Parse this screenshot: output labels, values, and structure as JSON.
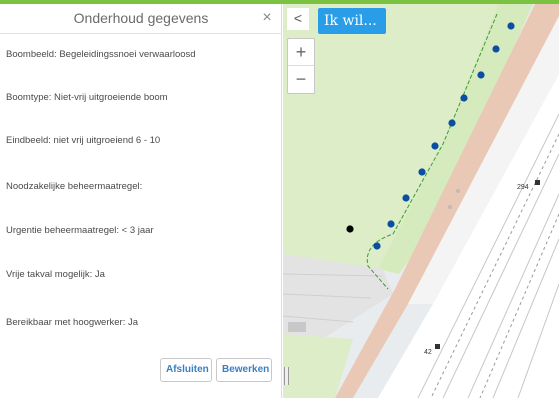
{
  "panel": {
    "title": "Onderhoud gegevens",
    "close_icon": "×",
    "fields": [
      "Boombeeld: Begeleidingssnoei verwaarloosd",
      "Boomtype: Niet-vrij uitgroeiende boom",
      "Eindbeeld: niet vrij uitgroeiend 6 - 10",
      "Noodzakelijke beheermaatregel:",
      "Urgentie beheermaatregel: < 3 jaar",
      "Vrije takval mogelijk: Ja",
      "Bereikbaar met hoogwerker: Ja"
    ],
    "buttons": {
      "close": "Afsluiten",
      "edit": "Bewerken"
    }
  },
  "map": {
    "collapse_icon": "<",
    "ik_wil": "Ik wil...",
    "zoom_in": "+",
    "zoom_out": "−",
    "house_numbers": [
      "294",
      "42"
    ],
    "colors": {
      "grass": "#dcedc8",
      "road": "#ffffff",
      "cycle_path": "#e8c9b8",
      "border_line": "#3f9b2e",
      "tree_dot": "#0b4ea2",
      "selected_dot": "#000000"
    }
  },
  "theme": {
    "accent": "#7cc242",
    "button_blue": "#2a9de8",
    "link_blue": "#3a7fc4"
  }
}
